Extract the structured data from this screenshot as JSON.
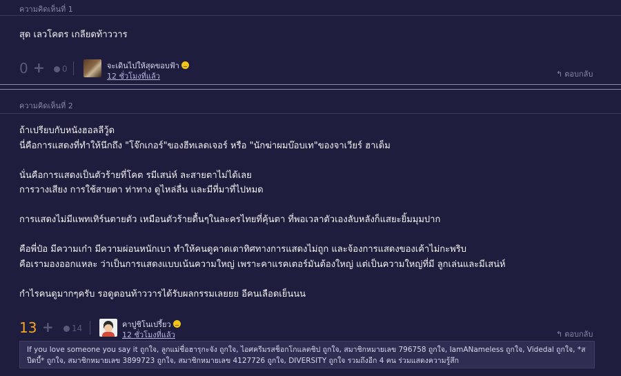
{
  "comments": [
    {
      "header": "ความคิดเห็นที่ 1",
      "text": "สุด เลวโคตร เกลียดท้าววาร",
      "score": "0",
      "plus": "+",
      "emotion_count": "0",
      "user": "จะเดินไปให้สุดขอบฟ้า",
      "time": "12 ชั่วโมงที่แล้ว",
      "reply": "ตอบกลับ"
    },
    {
      "header": "ความคิดเห็นที่ 2",
      "text": "ถ้าเปรียบกับหนังฮอลลีวู้ด\nนี่คือการแสดงที่ทำให้นึกถึง \"โจ๊กเกอร์\"ของฮีทเลดเจอร์ หรือ \"นักฆ่าผมบ๊อบเท\"ของจาเวียร์ ฮาเด็ม\n\nนั่นคือการแสดงเป็นตัวร้ายที่โคต รมีเสน่ห์ ละสายตาไม่ได้เลย\nการวางเสียง การใช้สายตา ท่าทาง ดูไหล่ลื่น และมีที่มาที่ไปหมด\n\nการแสดงไม่มีแพทเทิร์นตายตัว เหมือนตัวร้ายดื้นๆในละครไทยที่คุ้นตา ที่พอเวลาตัวเองลับหลังก็แสยะยิ้มมุมปาก\n\nคือพี่ป๋อ มีความเก๋า มีความผ่อนหนักเบา ทำให้คนดูคาดเดาทิศทางการแสดงไม่ถูก และจ้องการแสดงของเค้าไม่กะพริบ\nคือเรามองออกแหละ ว่าเป็นการแสดงแบบเน้นความใหญ่ เพราะคาแรคเตอร์มันต้องใหญ่ แต่เป็นความใหญ่ที่มี ลูกเล่นและมีเสน่ห์\n\nกำไรคนดูมากๆครับ รอดูตอนท้าววารได้รับผลกรรมเลยยย อีคนเลือดเย็นนน",
      "score": "13",
      "plus": "+",
      "emotion_count": "14",
      "user": "คาปูชิโนเปรี้ยว",
      "time": "12 ชั่วโมงที่แล้ว",
      "reply": "ตอบกลับ",
      "likers": "If you love someone you say it ถูกใจ, ลูกแม่ชื่อฮารุกะจัง ถูกใจ, ไอศครีมรสช็อกโกแลตชิป ถูกใจ, สมาชิกหมายเลข 796758 ถูกใจ, IamANameless ถูกใจ, Videdal ถูกใจ, *สปีดบี้* ถูกใจ, สมาชิกหมายเลข 3899723 ถูกใจ, สมาชิกหมายเลข 4127726 ถูกใจ, DIVERSITY ถูกใจ รวมถึงอีก 4 คน ร่วมแสดงความรู้สึก"
    }
  ],
  "colors": {
    "background": "#1f1d3d",
    "score_zero": "#5b5978",
    "score_positive": "#f5a623",
    "emoji": "#f2c318"
  },
  "icons": [
    "plus-icon",
    "emotion-icon",
    "smile-emoji-icon",
    "reply-arrow-icon"
  ]
}
